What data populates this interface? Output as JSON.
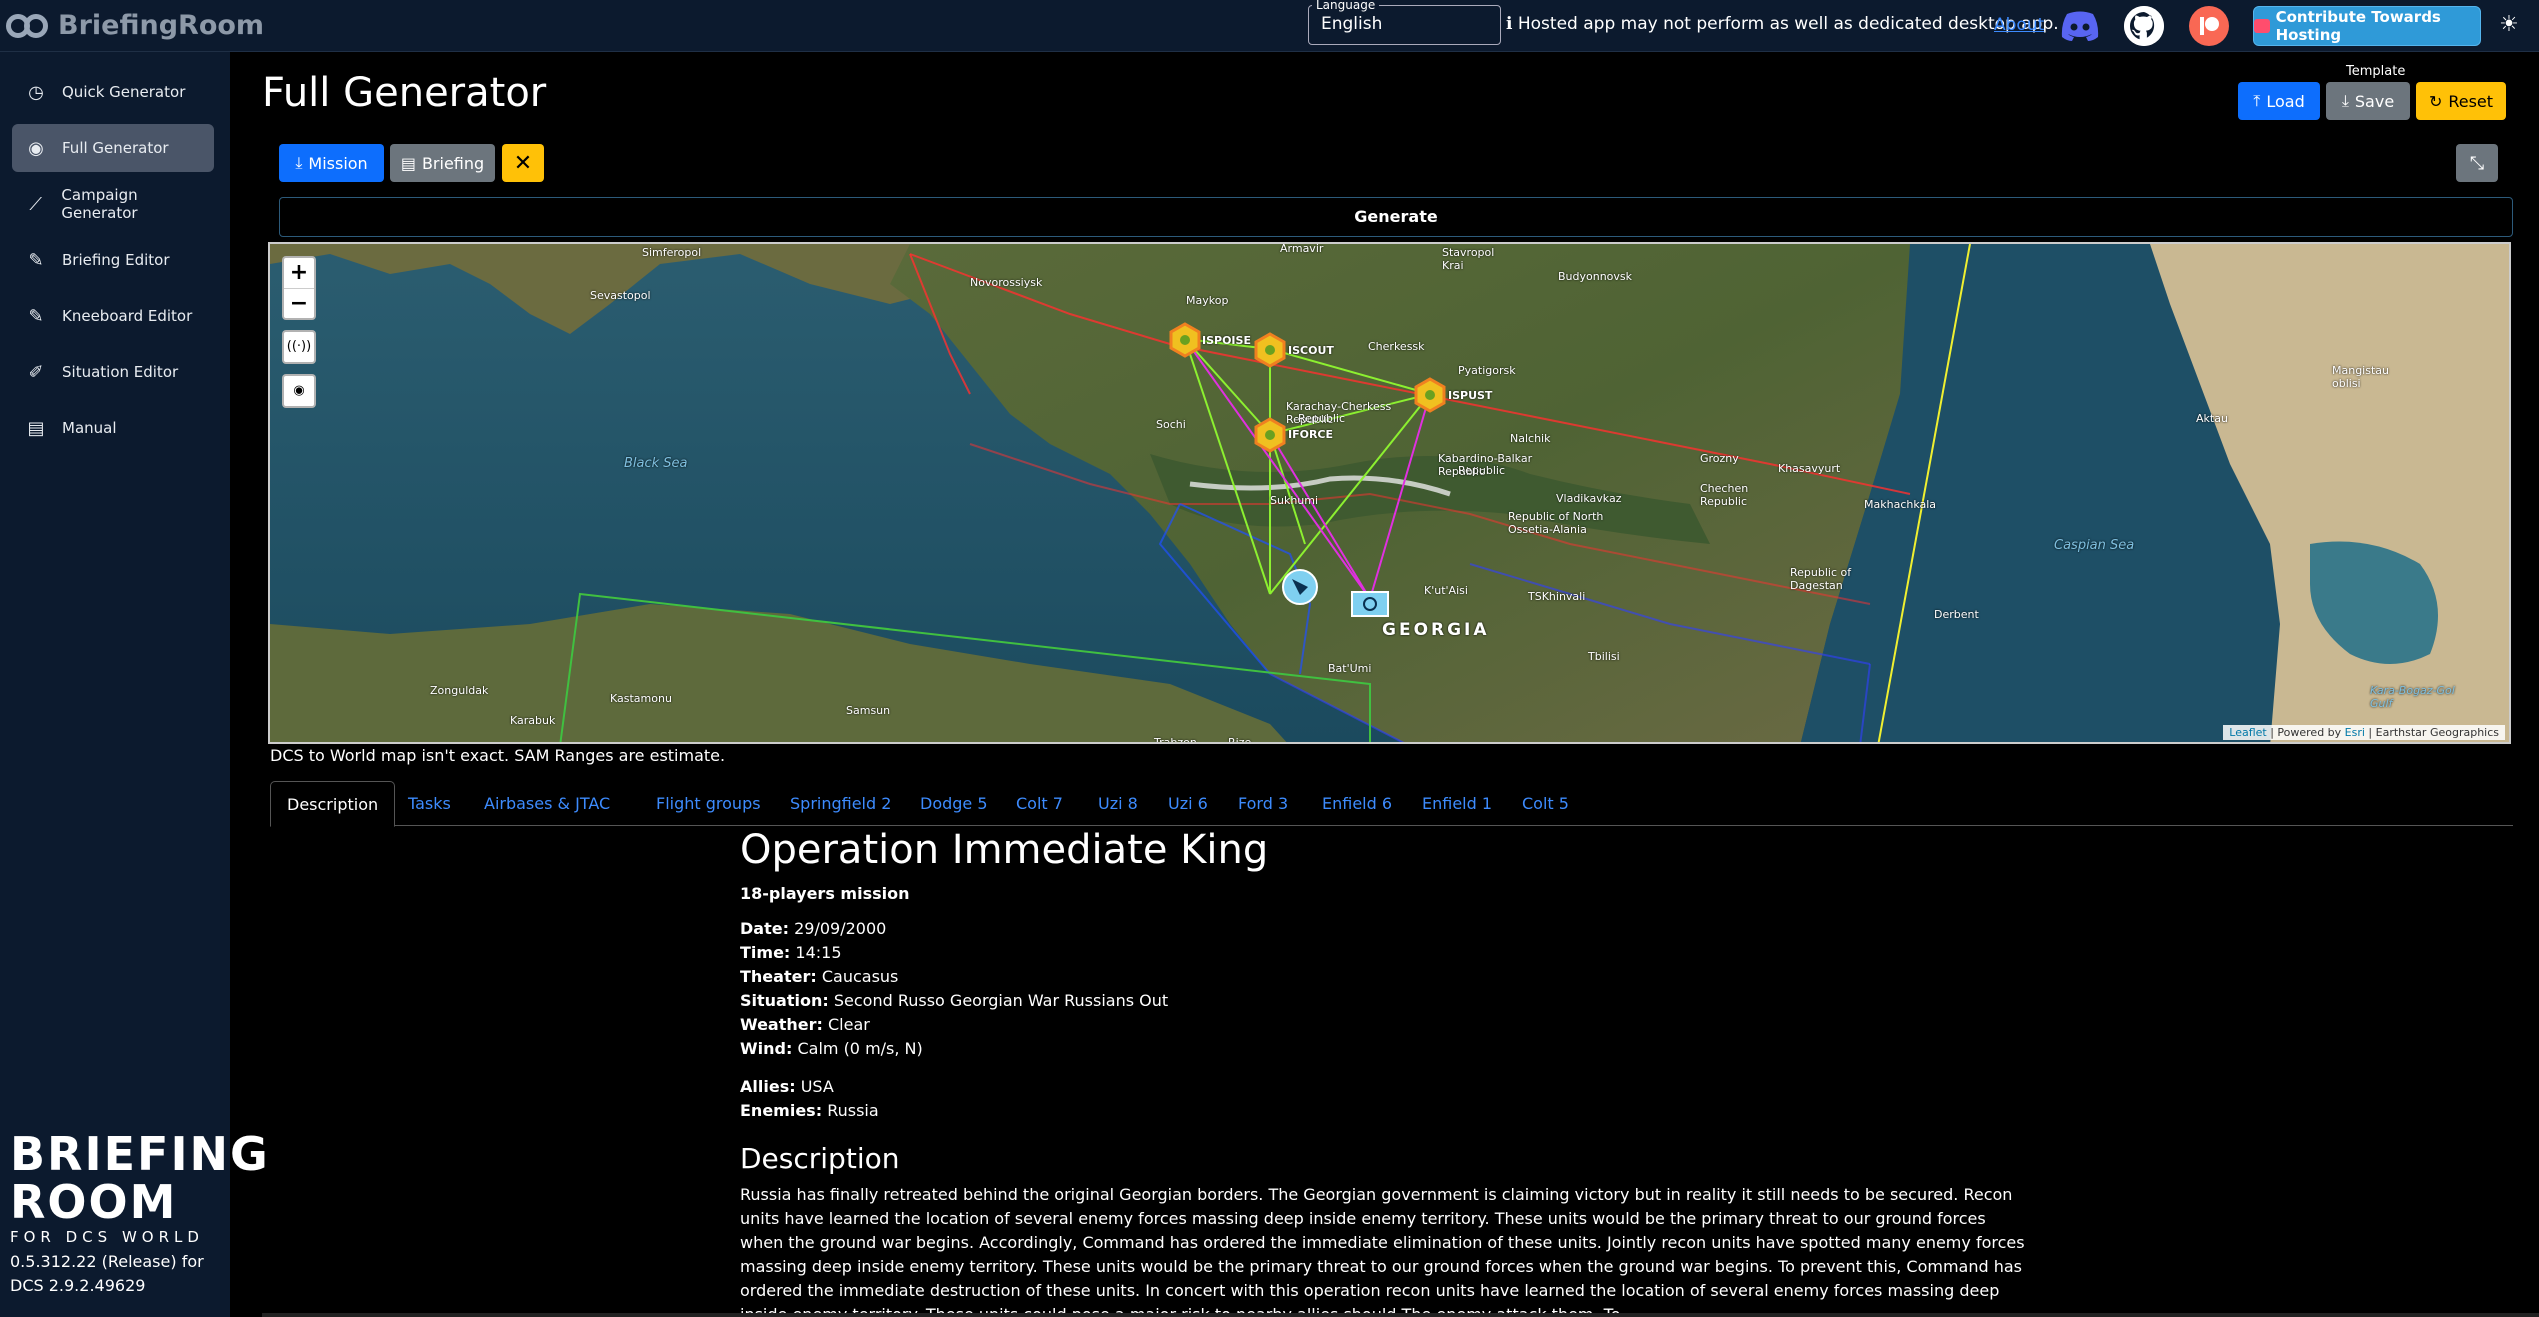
{
  "app": {
    "logo_text": "BriefingRoom",
    "language_label": "Language",
    "language_value": "English",
    "hosted_note": "Hosted app may not perform as well as dedicated desktop app.",
    "about": "About",
    "contribute": "Contribute Towards Hosting"
  },
  "sidebar": {
    "items": [
      {
        "label": "Quick Generator",
        "icon": "clock-icon"
      },
      {
        "label": "Full Generator",
        "icon": "compass-icon"
      },
      {
        "label": "Campaign Generator",
        "icon": "chart-icon"
      },
      {
        "label": "Briefing Editor",
        "icon": "pen-icon"
      },
      {
        "label": "Kneeboard Editor",
        "icon": "pen-icon"
      },
      {
        "label": "Situation Editor",
        "icon": "brush-icon"
      },
      {
        "label": "Manual",
        "icon": "book-icon"
      }
    ],
    "brand_line1": "BRIEFING",
    "brand_line2": "ROOM",
    "brand_sub": "FOR DCS WORLD",
    "version_line1": "0.5.312.22 (Release) for",
    "version_line2": "DCS 2.9.2.49629"
  },
  "main": {
    "title": "Full Generator",
    "template_label": "Template",
    "load": "Load",
    "save": "Save",
    "reset": "Reset",
    "mission_btn": "Mission",
    "briefing_btn": "Briefing",
    "generate": "Generate"
  },
  "map": {
    "note": "DCS to World map isn't exact. SAM Ranges are estimate.",
    "attribution_leaflet": "Leaflet",
    "attribution_rest": " | Powered by ",
    "attribution_esri": "Esri",
    "attribution_end": " | Earthstar Geographics",
    "labels": {
      "simferopol": "Simferopol",
      "sevastopol": "Sevastopol",
      "novorossiysk": "Novorossiysk",
      "maykop": "Maykop",
      "armavir": "Armavir",
      "stavropol": "Stavropol\nKrai",
      "budyonnovsk": "Budyonnovsk",
      "cherkessk": "Cherkessk",
      "pyatigorsk": "Pyatigorsk",
      "karachay": "Karachay-Cherkess\nRepublic",
      "sochi": "Sochi",
      "nalchik": "Nalchik",
      "kabardino": "Kabardino-Balkar\nRepublic",
      "grozny": "Grozny",
      "khasavyurt": "Khasavyurt",
      "chechen": "Chechen\nRepublic",
      "vladikavkaz": "Vladikavkaz",
      "north_ossetia": "Republic of North\nOssetia-Alania",
      "makhachkala": "Makhachkala",
      "dagestan": "Republic of\nDagestan",
      "sukhumi": "Sukhumi",
      "kutaisi": "K'ut'Aisi",
      "tskhinvali": "TSKhinvali",
      "georgia": "GEORGIA",
      "batumi": "Bat'Umi",
      "tbilisi": "Tbilisi",
      "derbent": "Derbent",
      "black_sea": "Black Sea",
      "caspian": "Caspian Sea",
      "mangistau": "Mangistau\noblisi",
      "aktau": "Aktau",
      "zonguldak": "Zonguldak",
      "kastamonu": "Kastamonu",
      "karabuk": "Karabuk",
      "samsun": "Samsun",
      "trabzon": "Trabzon",
      "rize": "Rize",
      "kara_bogaz": "Kara-Bogaz-Gol\nGulf",
      "unit_a": "ISPOISE",
      "unit_b": "ISCOUT",
      "unit_c": "ISPUST",
      "unit_d": "IFORCE"
    }
  },
  "tabs": [
    "Description",
    "Tasks",
    "Airbases & JTAC",
    "Flight groups",
    "Springfield 2",
    "Dodge 5",
    "Colt 7",
    "Uzi 8",
    "Uzi 6",
    "Ford 3",
    "Enfield 6",
    "Enfield 1",
    "Colt 5"
  ],
  "briefing": {
    "title": "Operation Immediate King",
    "players": "18-players mission",
    "date_label": "Date:",
    "date": "29/09/2000",
    "time_label": "Time:",
    "time": "14:15",
    "theater_label": "Theater:",
    "theater": "Caucasus",
    "situation_label": "Situation:",
    "situation": "Second Russo Georgian War Russians Out",
    "weather_label": "Weather:",
    "weather": "Clear",
    "wind_label": "Wind:",
    "wind": "Calm (0 m/s, N)",
    "allies_label": "Allies:",
    "allies": "USA",
    "enemies_label": "Enemies:",
    "enemies": "Russia",
    "desc_heading": "Description",
    "desc_text": "Russia has finally retreated behind the original Georgian borders. The Georgian government is claiming victory but in reality it still needs to be secured. Recon units have learned the location of several enemy forces massing deep inside enemy territory. These units would be the primary threat to our ground forces when the ground war begins. Accordingly, Command has ordered the immediate elimination of these units. Jointly recon units have spotted many enemy forces massing deep inside enemy territory. These units would be the primary threat to our ground forces when the ground war begins. To prevent this, Command has ordered the immediate destruction of these units. In concert with this operation recon units have learned the location of several enemy forces massing deep inside enemy territory. These units could pose a major risk to nearby allies should The enemy attack them. To"
  },
  "colors": {
    "accent": "#0d6efd",
    "warning": "#ffc107",
    "secondary": "#6c757d",
    "sidebar_bg": "#0c1a2e"
  }
}
